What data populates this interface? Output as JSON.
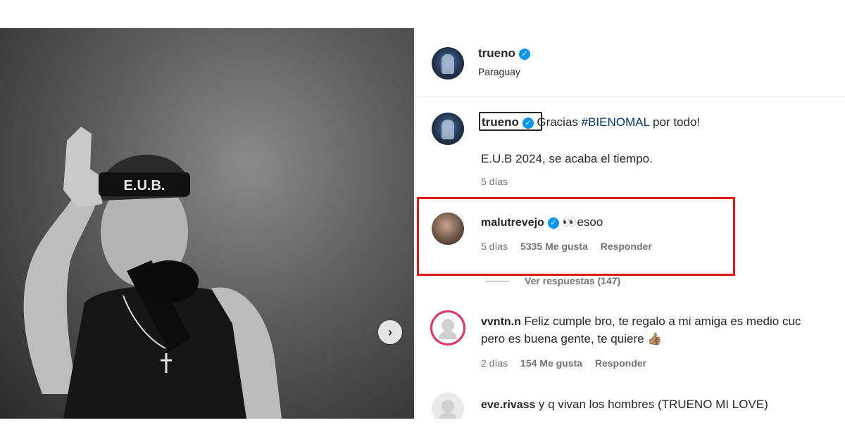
{
  "post": {
    "author": "trueno",
    "location": "Paraguay",
    "caption_user": "trueno",
    "caption_pre": "Gracias ",
    "caption_tag": "#BIENOMAL",
    "caption_post": " por todo!",
    "caption_line2": "E.U.B 2024, se acaba el tiempo.",
    "caption_age": "5 días",
    "headband_text": "E.U.B."
  },
  "comments": [
    {
      "user": "malutrevejo",
      "verified": true,
      "text": "esoo",
      "emoji": "👀",
      "age": "5 días",
      "likes": "5335 Me gusta",
      "reply": "Responder",
      "view_replies": "Ver respuestas (147)"
    },
    {
      "user": "vvntn.n",
      "verified": false,
      "text": "Feliz cumple bro, te regalo a mi amiga es medio cuc",
      "text_line2": "pero es buena gente, te quiere",
      "emoji": "👍🏽",
      "age": "2 días",
      "likes": "154 Me gusta",
      "reply": "Responder"
    },
    {
      "user": "eve.rivass",
      "verified": false,
      "text": "y q vivan los hombres (TRUENO MI LOVE)"
    }
  ],
  "icons": {
    "verified": "check",
    "next": "›"
  },
  "colors": {
    "highlight": "#e0161b",
    "verified": "#0095f6",
    "hashtag": "#00376b"
  }
}
